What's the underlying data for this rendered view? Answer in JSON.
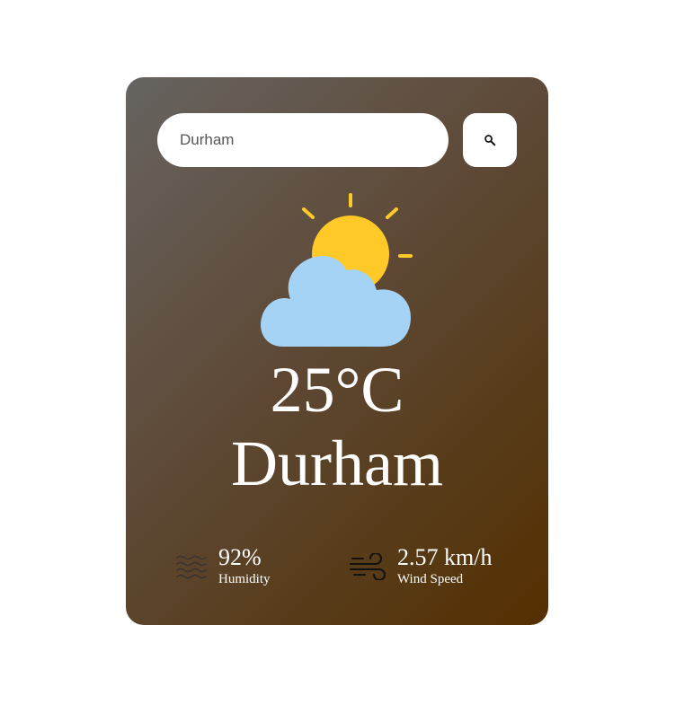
{
  "search": {
    "value": "Durham",
    "button_icon": "search-icon"
  },
  "weather": {
    "icon": "partly-cloudy-icon",
    "temperature": "25°C",
    "city": "Durham"
  },
  "details": {
    "humidity": {
      "icon": "water-waves-icon",
      "value": "92%",
      "label": "Humidity"
    },
    "wind": {
      "icon": "wind-icon",
      "value": "2.57 km/h",
      "label": "Wind Speed"
    }
  },
  "colors": {
    "sun": "#FFCA28",
    "cloud": "#A4D3F5",
    "card_gradient_start": "#676461",
    "card_gradient_end": "#552F00"
  }
}
